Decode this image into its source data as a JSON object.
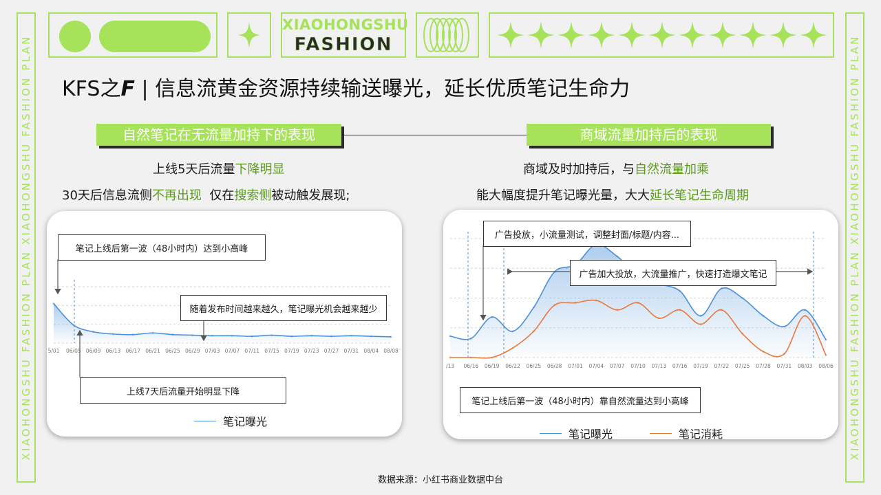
{
  "brand": {
    "side_text": "XIAOHONGSHU FASHION PLAN XIAOHONGSHU FASHION PLAN",
    "logo_line1": "XIAOHONGSHU",
    "logo_line2": "FASHION",
    "accent": "#a6e25a"
  },
  "title": {
    "prefix": "KFS之",
    "letter": "F",
    "rest": "| 信息流黄金资源持续输送曝光，延长优质笔记生命力"
  },
  "left": {
    "label": "自然笔记在无流量加持下的表现",
    "line1": {
      "a": "上线5天后流量",
      "b": "下降明显"
    },
    "line2": {
      "a": "30天后信息流侧",
      "b": "不再出现",
      "c": "  仅在",
      "d": "搜索侧",
      "e": "被动触发展现;"
    },
    "notes": {
      "peak": "笔记上线后第一波（48小时内）达到小高峰",
      "decline": "随着发布时间越来越久，笔记曝光机会越来越少",
      "day7": "上线7天后流量开始明显下降"
    }
  },
  "right": {
    "label": "商域流量加持后的表现",
    "line1": {
      "a": "商域及时加持后，与",
      "b": "自然流量加乘"
    },
    "line2": {
      "a": "能大幅度提升笔记曝光量，大大",
      "b": "延长笔记生命周期"
    },
    "notes": {
      "ad_test": "广告投放，小流量测试，调整封面/标题/内容...",
      "ad_boost": "广告加大投放，大流量推广，快速打造爆文笔记",
      "natural_peak": "笔记上线后第一波（48小时内）靠自然流量达到小高峰"
    }
  },
  "source": "数据来源：小红书商业数据中台",
  "chart_data": [
    {
      "type": "area",
      "x": [
        "5/01",
        "06/05",
        "06/09",
        "06/13",
        "06/17",
        "06/21",
        "06/25",
        "06/29",
        "07/03",
        "07/07",
        "07/11",
        "07/15",
        "07/19",
        "07/23",
        "07/27",
        "07/31",
        "08/04",
        "08/08"
      ],
      "series": [
        {
          "name": "笔记曝光",
          "color": "#4a90d9",
          "values": [
            0.7,
            0.32,
            0.2,
            0.16,
            0.15,
            0.18,
            0.15,
            0.14,
            0.13,
            0.13,
            0.12,
            0.14,
            0.12,
            0.13,
            0.12,
            0.13,
            0.12,
            0.11
          ]
        }
      ],
      "ylim": [
        0,
        1
      ],
      "grid": true,
      "legend": "bottom"
    },
    {
      "type": "line",
      "x": [
        "/13",
        "06/16",
        "06/19",
        "06/22",
        "06/25",
        "06/28",
        "07/01",
        "07/04",
        "07/07",
        "07/10",
        "07/13",
        "07/16",
        "07/19",
        "07/22",
        "07/25",
        "07/28",
        "07/31",
        "08/03",
        "08/06"
      ],
      "series": [
        {
          "name": "笔记曝光",
          "color": "#4a90d9",
          "fill": true,
          "values": [
            0.18,
            0.16,
            0.34,
            0.22,
            0.42,
            0.72,
            0.78,
            0.95,
            0.85,
            0.7,
            0.62,
            0.56,
            0.35,
            0.58,
            0.5,
            0.35,
            0.26,
            0.4,
            0.15
          ]
        },
        {
          "name": "笔记消耗",
          "color": "#e8783c",
          "values": [
            0.0,
            0.0,
            0.0,
            0.08,
            0.22,
            0.44,
            0.46,
            0.48,
            0.4,
            0.46,
            0.33,
            0.4,
            0.28,
            0.4,
            0.2,
            0.05,
            0.03,
            0.35,
            0.02
          ]
        }
      ],
      "ylim": [
        0,
        1
      ],
      "grid": true,
      "legend": "bottom"
    }
  ]
}
